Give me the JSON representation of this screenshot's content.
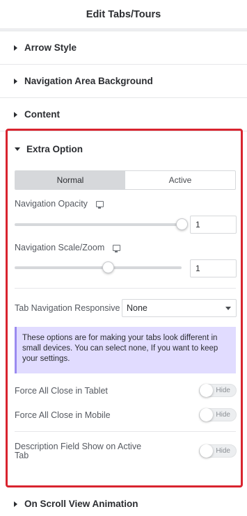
{
  "header": {
    "title": "Edit Tabs/Tours"
  },
  "sections": {
    "arrow_style": "Arrow Style",
    "nav_bg": "Navigation Area Background",
    "content": "Content",
    "extra_option": "Extra Option",
    "on_scroll": "On Scroll View Animation"
  },
  "extra": {
    "tabs": {
      "normal": "Normal",
      "active": "Active",
      "selected": "Normal"
    },
    "nav_opacity": {
      "label": "Navigation Opacity",
      "value": "1",
      "fraction": 1.0,
      "device_icon": "desktop-monitor-icon"
    },
    "nav_scale": {
      "label": "Navigation Scale/Zoom",
      "value": "1",
      "fraction": 0.56,
      "device_icon": "desktop-monitor-icon"
    },
    "responsive": {
      "label": "Tab Navigation Responsive",
      "value": "None"
    },
    "notice": "These options are for making your tabs look different in small devices. You can select none, If you want to keep your settings.",
    "force_tablet": {
      "label": "Force All Close in Tablet",
      "toggle": "Hide"
    },
    "force_mobile": {
      "label": "Force All Close in Mobile",
      "toggle": "Hide"
    },
    "desc_field": {
      "label": "Description Field Show on Active Tab",
      "toggle": "Hide"
    }
  },
  "colors": {
    "highlight_border": "#d9242f",
    "notice_bg": "#e1dcff",
    "notice_border": "#9b8bf0"
  }
}
